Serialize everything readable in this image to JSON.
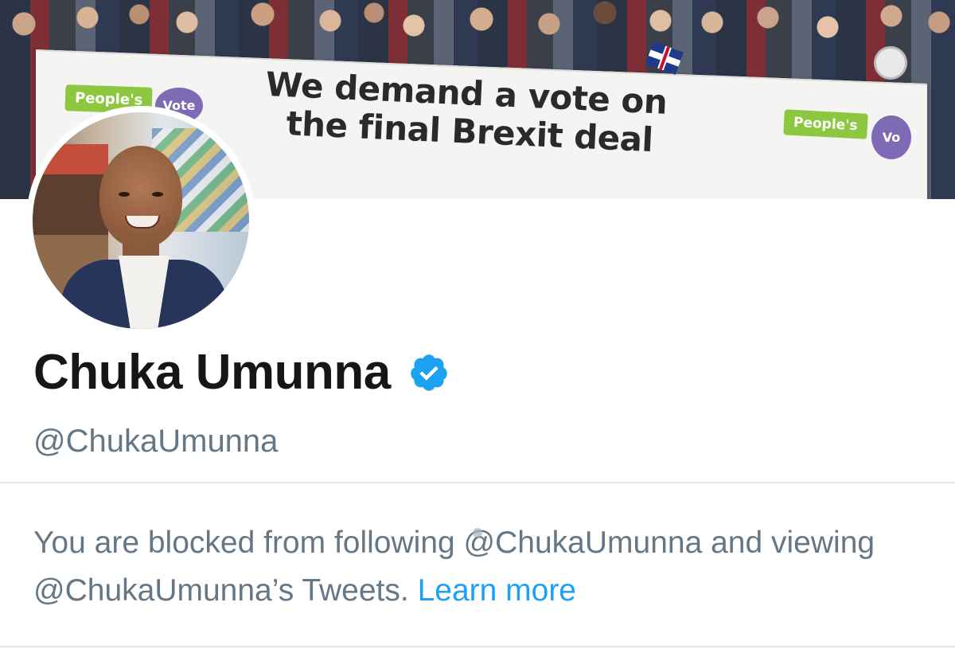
{
  "banner": {
    "slogan_line1": "We demand a vote on",
    "slogan_line2": "the final Brexit deal",
    "logo_left_text": "People's",
    "logo_left_bubble": "Vote",
    "logo_right_text": "People's",
    "logo_right_bubble": "Vo"
  },
  "profile": {
    "display_name": "Chuka Umunna",
    "verified": true,
    "handle": "@ChukaUmunna"
  },
  "blocked_notice": {
    "message": "You are blocked from following @ChukaUmunna and viewing @ChukaUmunna’s Tweets.",
    "link_label": "Learn more"
  },
  "colors": {
    "text_primary": "#14171a",
    "text_secondary": "#657786",
    "link": "#1da1f2",
    "verified_badge": "#1da1f2",
    "divider": "#e1e8ed",
    "peoples_vote_green": "#8dc63f",
    "peoples_vote_purple": "#7f6bb5"
  },
  "icons": {
    "verified": "verified-badge-icon"
  }
}
